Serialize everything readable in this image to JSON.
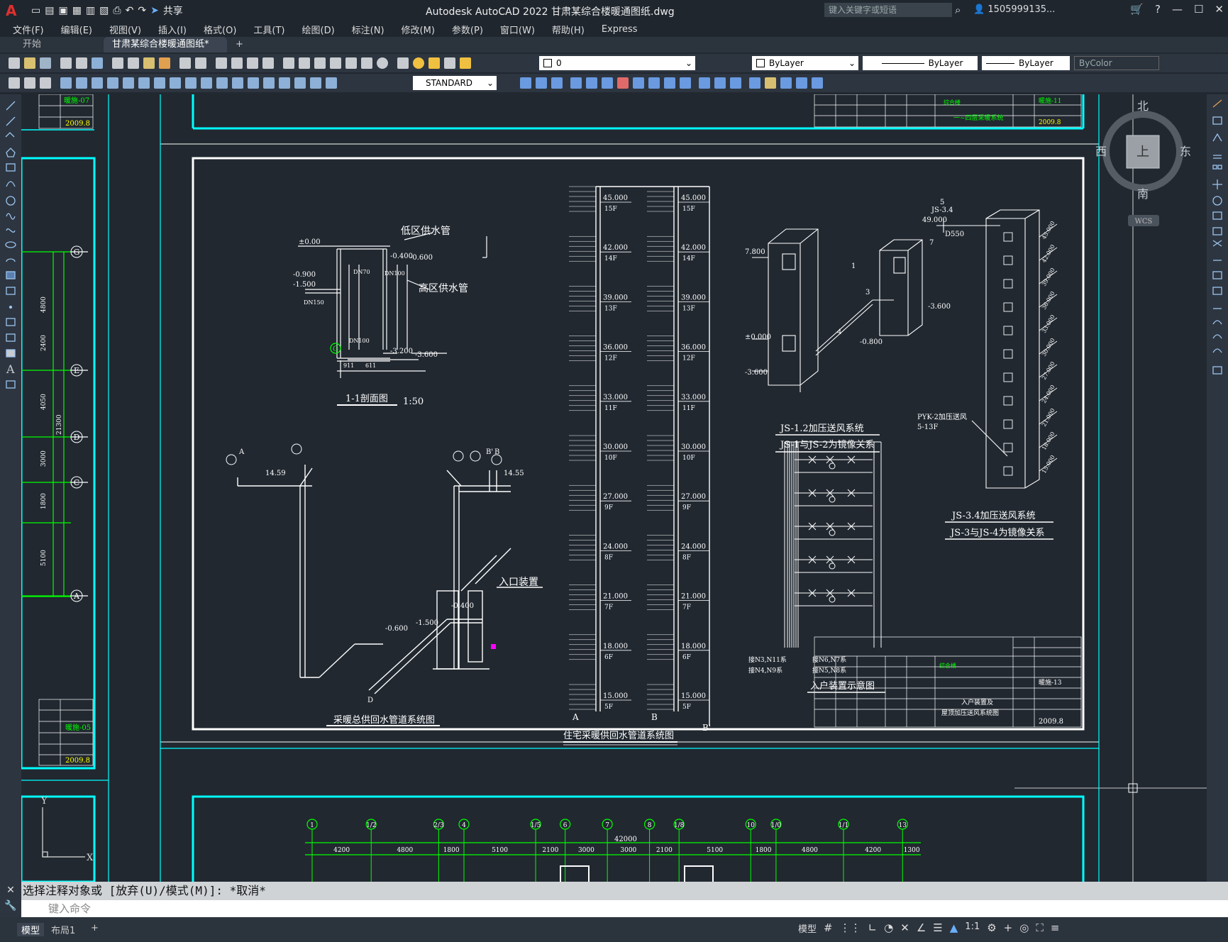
{
  "app": {
    "title": "Autodesk AutoCAD 2022    甘肃某综合楼暖通图纸.dwg",
    "share": "共享",
    "search_placeholder": "键入关键字或短语",
    "user": "1505999135...",
    "logo": "A"
  },
  "menu": [
    "文件(F)",
    "编辑(E)",
    "视图(V)",
    "插入(I)",
    "格式(O)",
    "工具(T)",
    "绘图(D)",
    "标注(N)",
    "修改(M)",
    "参数(P)",
    "窗口(W)",
    "帮助(H)",
    "Express"
  ],
  "tabs": {
    "start": "开始",
    "document": "甘肃某综合楼暖通图纸*",
    "add": "+"
  },
  "toolbar": {
    "layer": "0",
    "color": "ByLayer",
    "linetype": "ByLayer",
    "lineweight": "ByLayer",
    "plotstyle": "ByColor",
    "textstyle": "STANDARD"
  },
  "viewcube": {
    "north": "北",
    "south": "南",
    "east": "东",
    "west": "西",
    "top": "上",
    "wcs": "WCS"
  },
  "drawing": {
    "section_title": "1-1剖面图",
    "section_scale": "1:50",
    "low_zone": "低区供水管",
    "high_zone": "高区供水管",
    "heating_title": "采暖总供回水管道系统图",
    "entry_device": "入口装置",
    "residential_title": "住宅采暖供回水管道系统图",
    "js12_title": "JS-1.2加压送风系统",
    "js12_sub": "JS-1与JS-2为镜像关系",
    "js34_title": "JS-3.4加压送风系统",
    "js34_sub": "JS-3与JS-4为镜像关系",
    "entry_diagram": "入户装置示意图",
    "elevations": [
      "45.000",
      "42.000",
      "39.000",
      "36.000",
      "33.000",
      "30.000",
      "27.000",
      "24.000",
      "21.000",
      "18.000",
      "15.000"
    ],
    "floors": [
      "15F",
      "14F",
      "13F",
      "12F",
      "11F",
      "10F",
      "9F",
      "8F",
      "7F",
      "6F",
      "5F"
    ],
    "col_a": "A",
    "col_b": "B",
    "col_b2": "B'",
    "date": "2009.8",
    "sheet_no": "暖施-13",
    "sheet_name1": "入户装置及",
    "sheet_name2": "屋顶加压送风系统图",
    "grid_labels": [
      "1",
      "1/2",
      "2/3",
      "4",
      "1/5",
      "6",
      "7",
      "8",
      "1/8",
      "10",
      "1/0",
      "1/1",
      "13"
    ],
    "grid_dims": [
      "4200",
      "4800",
      "1800",
      "5100",
      "2100",
      "3000",
      "3000",
      "2100",
      "5100",
      "1800",
      "4800",
      "4200",
      "1300"
    ],
    "grid_total": "42000",
    "axis_letters": [
      "G",
      "E",
      "D",
      "C",
      "A"
    ],
    "axis_dims": [
      "4800",
      "2400",
      "4050",
      "3000",
      "1800",
      "5100"
    ],
    "axis_total": "21300",
    "ucs_y": "Y",
    "ucs_x": "X"
  },
  "command": {
    "history": "选择注释对象或 [放弃(U)/模式(M)]: *取消*",
    "placeholder": "键入命令"
  },
  "status": {
    "model_tab": "模型",
    "layout_tab": "布局1",
    "model": "模型",
    "scale": "1:1"
  }
}
